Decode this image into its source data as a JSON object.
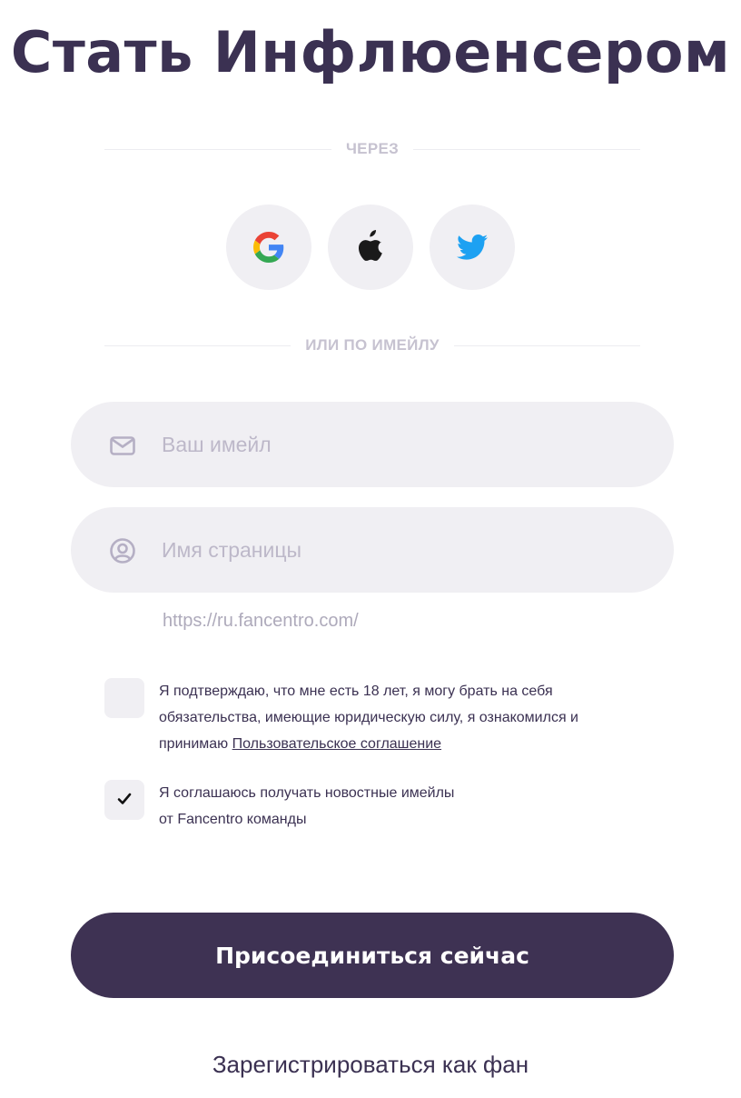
{
  "title": "Стать Инфлюенсером",
  "dividers": {
    "via": "ЧЕРЕЗ",
    "or_email": "ИЛИ ПО ИМЕЙЛУ"
  },
  "social": [
    {
      "name": "Google",
      "icon": "google-icon"
    },
    {
      "name": "Apple",
      "icon": "apple-icon"
    },
    {
      "name": "Twitter",
      "icon": "twitter-icon",
      "color": "#1da1f2"
    }
  ],
  "form": {
    "email": {
      "placeholder": "Ваш имейл",
      "value": "",
      "icon": "mail-icon"
    },
    "page_name": {
      "placeholder": "Имя страницы",
      "value": "",
      "icon": "user-circle-icon"
    },
    "url_prefix": "https://ru.fancentro.com/"
  },
  "agreements": {
    "age": {
      "checked": false,
      "line1": "Я подтверждаю, что мне есть 18 лет, я могу брать на себя",
      "line2": "обязательства, имеющие юридическую силу, я ознакомился и",
      "line3_prefix": "принимаю",
      "link": "Пользовательское соглашение"
    },
    "newsletter": {
      "checked": true,
      "line1": "Я соглашаюсь получать новостные имейлы",
      "line2": "от Fancentro команды"
    }
  },
  "join_button": "Присоединиться сейчас",
  "fan_link": "Зарегистрироваться как фан",
  "colors": {
    "primary": "#3e3253",
    "field_bg": "#f0eff3",
    "muted": "#c6c2d0",
    "twitter": "#1da1f2"
  }
}
